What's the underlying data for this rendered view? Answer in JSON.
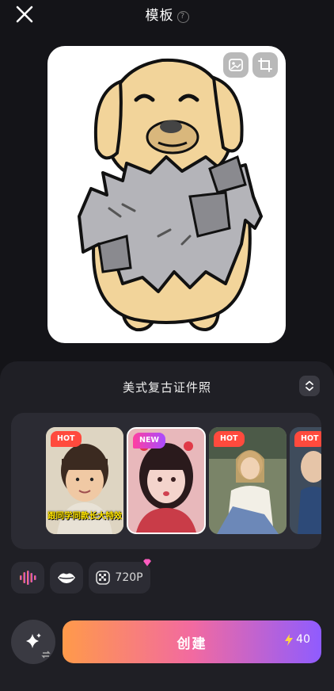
{
  "header": {
    "title": "模板",
    "help_glyph": "?"
  },
  "panel": {
    "template_name": "美式复古证件照"
  },
  "templates": [
    {
      "badge": "HOT",
      "caption": "跟同学同款长大特效"
    },
    {
      "badge": "NEW",
      "caption": ""
    },
    {
      "badge": "HOT",
      "caption": ""
    },
    {
      "badge": "HOT",
      "caption": ""
    }
  ],
  "options": {
    "resolution": "720P"
  },
  "actions": {
    "create_label": "创建",
    "cost": "40"
  },
  "colors": {
    "background": "#141418",
    "panel": "#1f1f25",
    "hot_badge": "#ff4a3d",
    "gradient_start": "#ff9a4a",
    "gradient_end": "#8f5cff"
  },
  "icons": [
    "close-icon",
    "help-icon",
    "image-swap-icon",
    "crop-icon",
    "expand-icon",
    "voice-wave-icon",
    "lips-icon",
    "resolution-icon",
    "sparkle-icon",
    "lightning-icon"
  ]
}
